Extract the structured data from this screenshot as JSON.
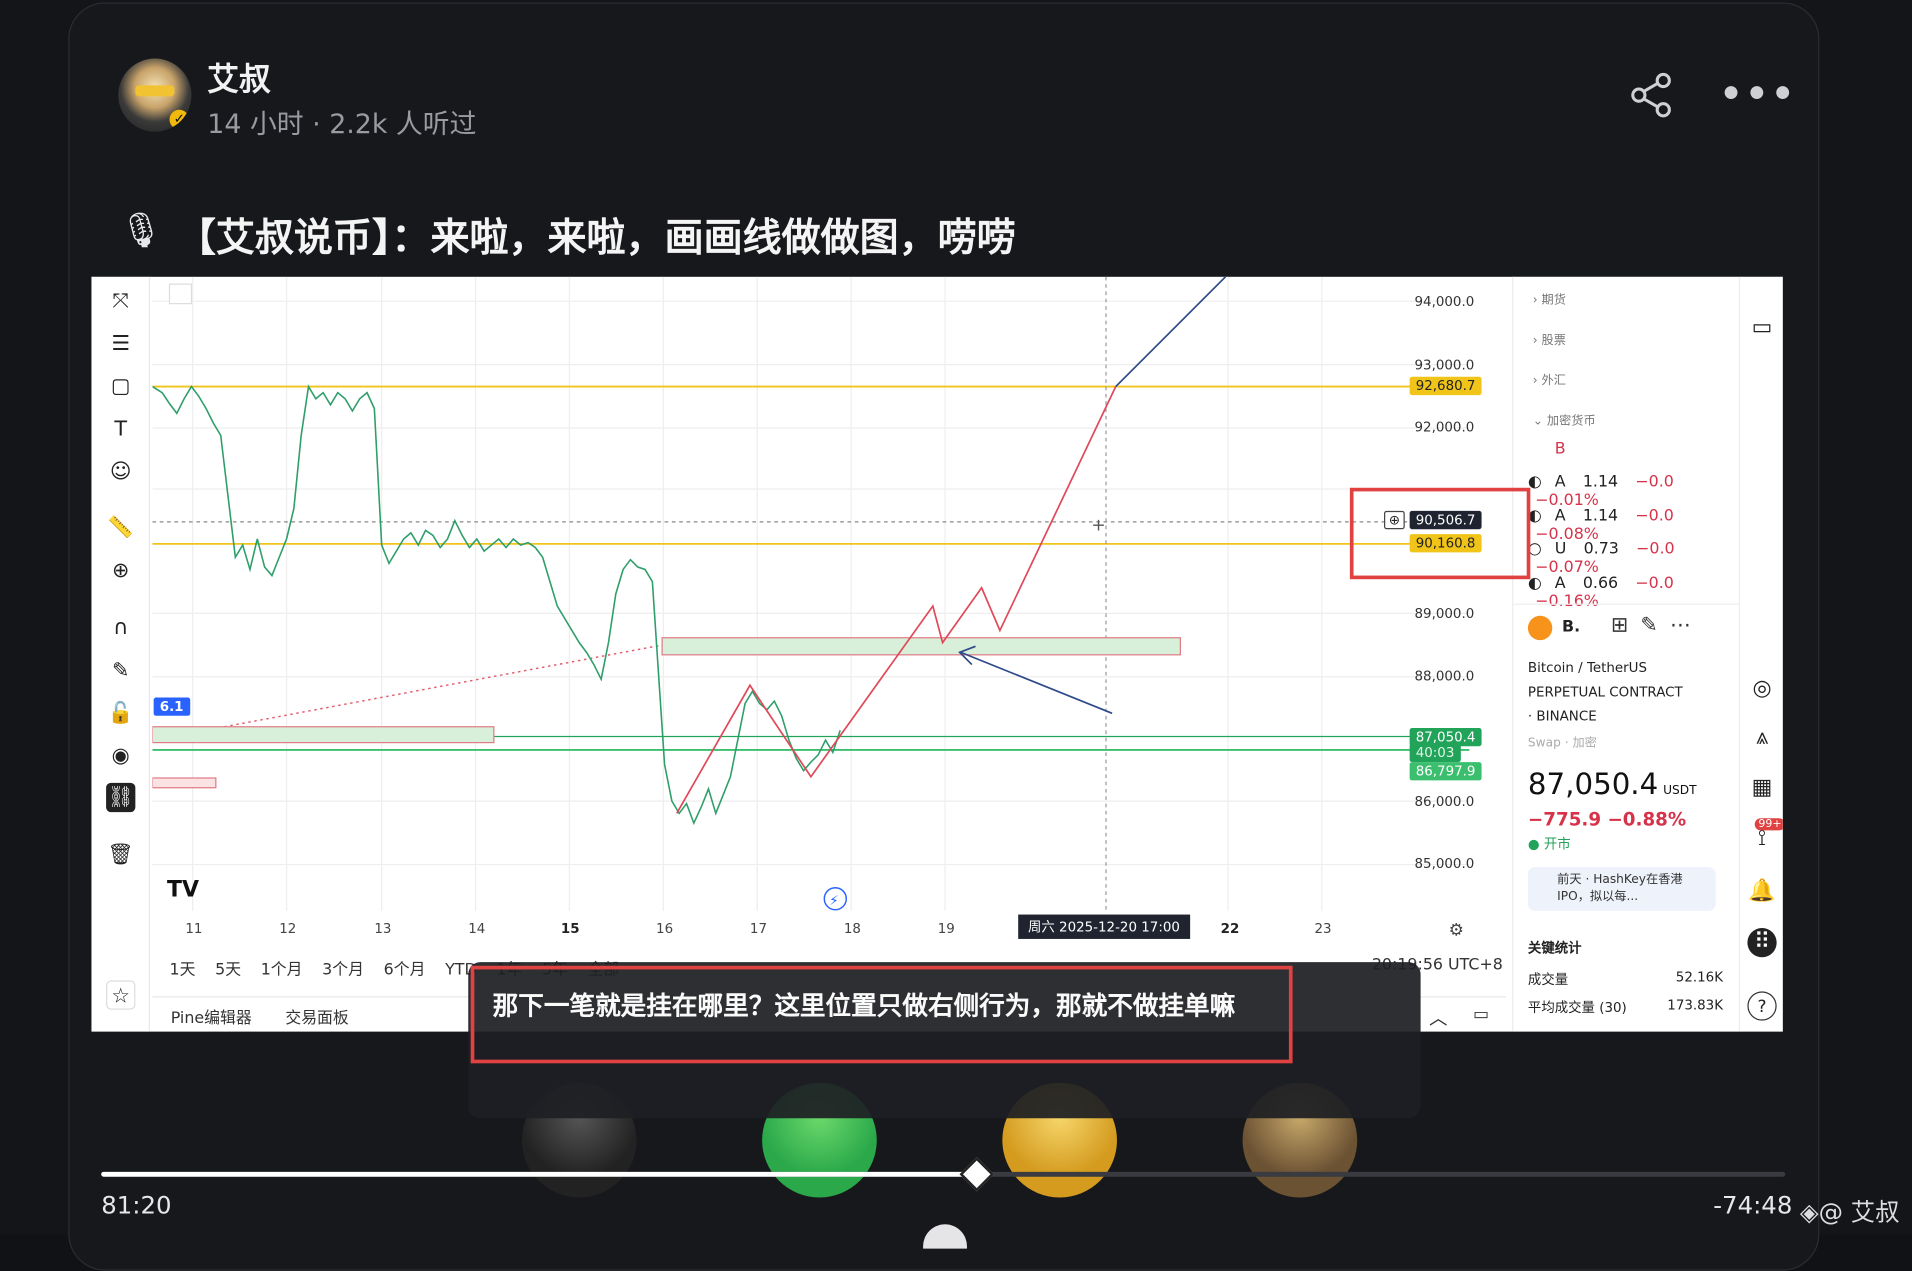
{
  "post": {
    "author": "艾叔",
    "meta": "14 小时 · 2.2k 人听过",
    "title": "【艾叔说币】：来啦，来啦，画画线做做图，唠唠",
    "title_icon": "microphone-icon"
  },
  "chart_ui": {
    "price_ticks": [
      "94,000.0",
      "93,000.0",
      "92,000.0",
      "89,000.0",
      "88,000.0",
      "86,000.0",
      "85,000.0"
    ],
    "price_labels": {
      "yellow_top": "92,680.7",
      "crosshair": "90,506.7",
      "yellow_mid": "90,160.8",
      "green_top": "87,050.4",
      "countdown": "40:03",
      "green_bottom": "86,797.9"
    },
    "x_ticks": [
      "11",
      "12",
      "13",
      "14",
      "15",
      "16",
      "17",
      "18",
      "19",
      "22",
      "23"
    ],
    "crosshair_date": "周六 2025-12-20   17:00",
    "side_marker": "6.1",
    "logo": "TV",
    "ranges": "1天 5天 1个月 3个月 6个月 YTD 1年 5年 全部",
    "timezone": "20:19:56 UTC+8",
    "bottom_tabs": [
      "Pine编辑器",
      "交易面板"
    ]
  },
  "watchlist": {
    "categories": [
      "期货",
      "股票",
      "外汇",
      "加密货币"
    ],
    "rows": [
      {
        "sym": "B",
        "last": "",
        "chg": "",
        "pct": ""
      },
      {
        "sym": "A",
        "last": "1.14",
        "chg": "−0.0",
        "pct": "−0.01%"
      },
      {
        "sym": "A",
        "last": "1.14",
        "chg": "−0.0",
        "pct": "−0.08%"
      },
      {
        "sym": "U",
        "last": "0.73",
        "chg": "−0.0",
        "pct": "−0.07%"
      },
      {
        "sym": "A",
        "last": "0.66",
        "chg": "−0.0",
        "pct": "−0.16%"
      }
    ],
    "detail_symbol": "B.",
    "pair": "Bitcoin / TetherUS",
    "contract": "PERPETUAL CONTRACT",
    "exchange": "· BINANCE",
    "tags": "Swap · 加密",
    "price": "87,050.4",
    "currency": "USDT",
    "change": "−775.9  −0.88%",
    "market_status": "● 开市",
    "news": "前天 · HashKey在香港IPO，拟以每...",
    "stats_title": "关键统计",
    "stats": [
      {
        "label": "成交量",
        "value": "52.16K"
      },
      {
        "label": "平均成交量 (30)",
        "value": "173.83K"
      }
    ],
    "badge": "99+"
  },
  "caption": {
    "text": "那下一笔就是挂在哪里？这里位置只做右侧行为，那就不做挂单嘛"
  },
  "player": {
    "elapsed": "81:20",
    "remaining": "-74:48",
    "progress": 0.52,
    "watermark": "@ 艾叔"
  }
}
